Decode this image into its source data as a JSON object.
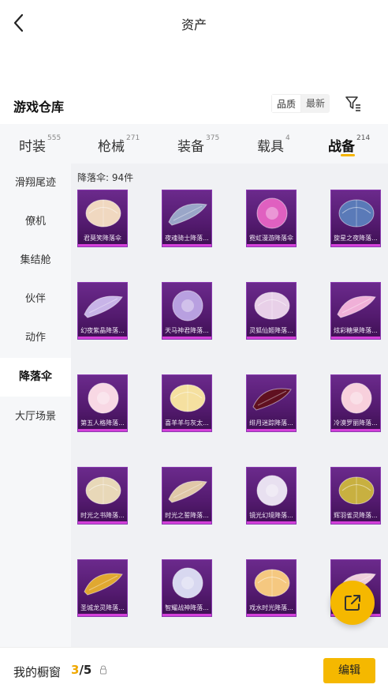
{
  "header": {
    "title": "资产"
  },
  "warehouse": {
    "title": "游戏仓库",
    "sort_options": [
      "品质",
      "最新"
    ]
  },
  "tabs": [
    {
      "label": "时装",
      "count": "555"
    },
    {
      "label": "枪械",
      "count": "271"
    },
    {
      "label": "装备",
      "count": "375"
    },
    {
      "label": "载具",
      "count": "4"
    },
    {
      "label": "战备",
      "count": "214"
    }
  ],
  "sidebar": {
    "items": [
      "滑翔尾迹",
      "僚机",
      "集结舱",
      "伙伴",
      "动作",
      "降落伞",
      "大厅场景"
    ]
  },
  "content": {
    "count_label": "降落伞: 94件",
    "items": [
      {
        "name": "君莫笑降落伞",
        "icon": "parachute-icon",
        "color": "#f0d8c0"
      },
      {
        "name": "夜魂骑士降落...",
        "icon": "parachute-icon",
        "color": "#9aa6c8"
      },
      {
        "name": "霓虹漫游降落伞",
        "icon": "parachute-icon",
        "color": "#e060c0"
      },
      {
        "name": "旋星之夜降落...",
        "icon": "parachute-icon",
        "color": "#5a7ab8"
      },
      {
        "name": "幻夜紫晶降落...",
        "icon": "parachute-icon",
        "color": "#c8b4e8"
      },
      {
        "name": "天马神君降落...",
        "icon": "parachute-icon",
        "color": "#b8a0e0"
      },
      {
        "name": "灵狐仙姬降落...",
        "icon": "parachute-icon",
        "color": "#e8d0e8"
      },
      {
        "name": "炫彩糖果降落...",
        "icon": "parachute-icon",
        "color": "#f0b0d8"
      },
      {
        "name": "第五人格降落...",
        "icon": "parachute-icon",
        "color": "#f8d8e4"
      },
      {
        "name": "喜羊羊与灰太...",
        "icon": "parachute-icon",
        "color": "#f5e0a0"
      },
      {
        "name": "绯月迷踪降落...",
        "icon": "parachute-icon",
        "color": "#601020"
      },
      {
        "name": "冷漠罗丽降落...",
        "icon": "parachute-icon",
        "color": "#f8d0dc"
      },
      {
        "name": "时光之书降落...",
        "icon": "parachute-icon",
        "color": "#e8d8b8"
      },
      {
        "name": "时光之誓降落...",
        "icon": "parachute-icon",
        "color": "#e0c8a8"
      },
      {
        "name": "镜光幻境降落...",
        "icon": "parachute-icon",
        "color": "#e8e0f0"
      },
      {
        "name": "辉羽雀灵降落...",
        "icon": "parachute-icon",
        "color": "#c8b040"
      },
      {
        "name": "圣城龙灵降落...",
        "icon": "parachute-icon",
        "color": "#e0a830"
      },
      {
        "name": "智耀战神降落...",
        "icon": "parachute-icon",
        "color": "#d8d8f0"
      },
      {
        "name": "戏水时光降落...",
        "icon": "parachute-icon",
        "color": "#f5c880"
      },
      {
        "name": "",
        "icon": "parachute-icon",
        "color": "#f0d0dc"
      }
    ]
  },
  "bottom": {
    "shelf_label": "我的橱窗",
    "shelf_current": "3",
    "shelf_total": "/5",
    "edit_label": "编辑"
  },
  "colors": {
    "accent": "#f5b800",
    "card_bg": "#531a6e",
    "card_border": "#d43fd9"
  }
}
